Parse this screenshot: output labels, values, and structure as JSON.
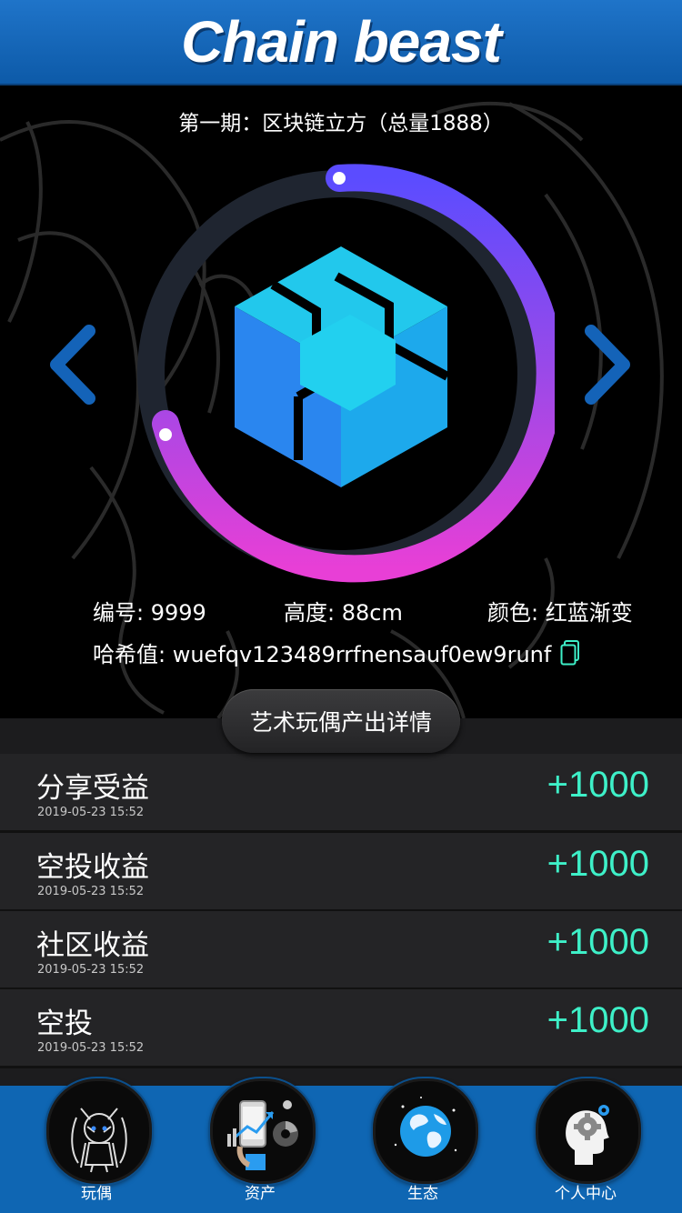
{
  "header": {
    "title": "Chain beast"
  },
  "hero": {
    "period_title": "第一期：区块链立方（总量1888）",
    "ring_colors": {
      "start": "#5b4cff",
      "end": "#e83fd6",
      "track": "#1f2530"
    },
    "cube_colors": {
      "top": "#2ad0f0",
      "left": "#2a8cf0",
      "right": "#1fb2ee"
    },
    "number": "编号: 9999",
    "height": "高度: 88cm",
    "color": "颜色: 红蓝渐变",
    "hash": "哈希值: wuefqv123489rrfnensauf0ew9runf"
  },
  "detail_button": {
    "label": "艺术玩偶产出详情"
  },
  "records": [
    {
      "name": "分享受益",
      "time": "2019-05-23  15:52",
      "amount": "+1000"
    },
    {
      "name": "空投收益",
      "time": "2019-05-23  15:52",
      "amount": "+1000"
    },
    {
      "name": "社区收益",
      "time": "2019-05-23  15:52",
      "amount": "+1000"
    },
    {
      "name": "空投",
      "time": "2019-05-23  15:52",
      "amount": "+1000"
    }
  ],
  "tabs": [
    {
      "label": "玩偶",
      "icon": "doll-icon"
    },
    {
      "label": "资产",
      "icon": "assets-chart-icon"
    },
    {
      "label": "生态",
      "icon": "globe-icon"
    },
    {
      "label": "个人中心",
      "icon": "profile-gear-icon"
    }
  ],
  "accent_colors": {
    "amount": "#3ef0c8",
    "tabbar": "#0f66b3",
    "arrow": "#1463b8"
  }
}
